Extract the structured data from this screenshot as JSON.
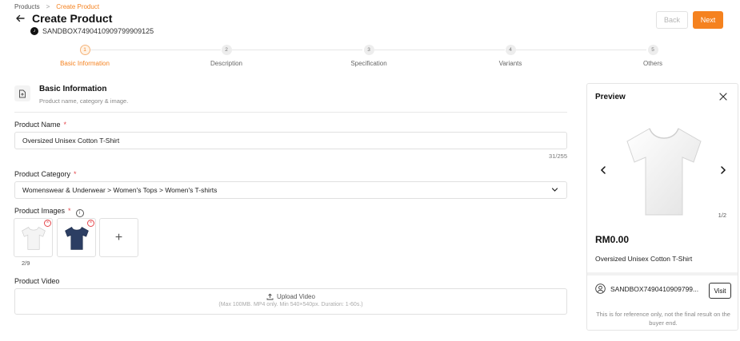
{
  "breadcrumb": {
    "parent": "Products",
    "separator": ">",
    "current": "Create Product"
  },
  "header": {
    "title": "Create Product",
    "shop_id": "SANDBOX7490410909799909125",
    "back_label": "Back",
    "next_label": "Next"
  },
  "steps": [
    {
      "number": "1",
      "label": "Basic Information",
      "active": true
    },
    {
      "number": "2",
      "label": "Description",
      "active": false
    },
    {
      "number": "3",
      "label": "Specification",
      "active": false
    },
    {
      "number": "4",
      "label": "Variants",
      "active": false
    },
    {
      "number": "5",
      "label": "Others",
      "active": false
    }
  ],
  "section": {
    "title": "Basic Information",
    "subtitle": "Product name, category & image."
  },
  "form": {
    "name_label": "Product Name",
    "name_value": "Oversized Unisex Cotton T-Shirt",
    "name_counter": "31/255",
    "category_label": "Product Category",
    "category_value": "Womenswear & Underwear > Women's Tops > Women's T-shirts",
    "images_label": "Product Images",
    "image_count": "2/9",
    "add_symbol": "+",
    "video_label": "Product Video",
    "upload_label": "Upload Video",
    "upload_hint": "(Max 100MB. MP4 only. Min 540×540px. Duration: 1-60s.)",
    "required_mark": "*"
  },
  "preview": {
    "title": "Preview",
    "page": "1/2",
    "price": "RM0.00",
    "name": "Oversized Unisex Cotton T-Shirt",
    "shop": "SANDBOX7490410909799...",
    "visit_label": "Visit",
    "note": "This is for reference only, not the final result on the buyer end."
  },
  "colors": {
    "accent": "#f5821f",
    "required": "#e5484d",
    "shirt_white": "#f4f4f4",
    "shirt_navy": "#2c3e63"
  }
}
